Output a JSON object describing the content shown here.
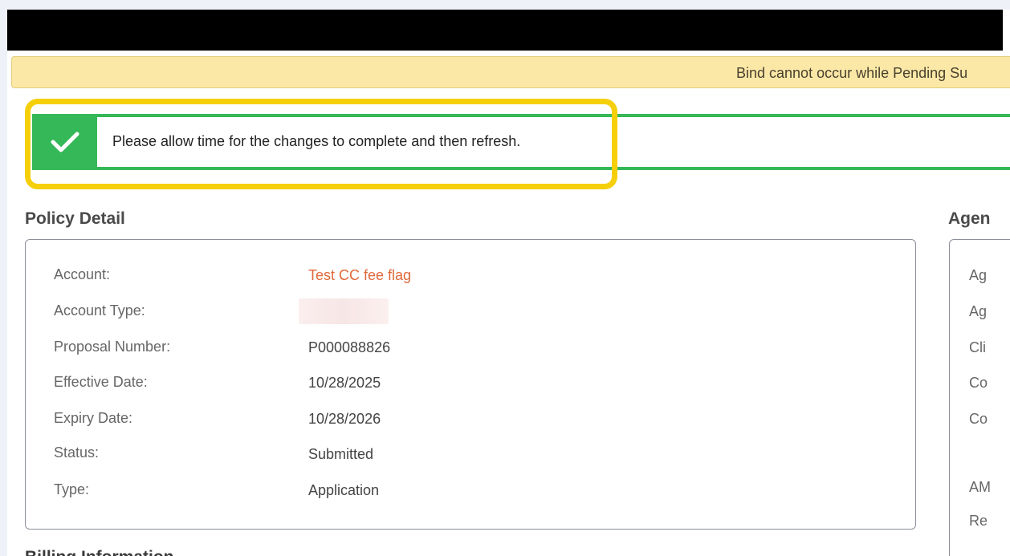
{
  "warning": {
    "text": "Bind cannot occur while Pending Su"
  },
  "success": {
    "message": "Please allow time for the changes to complete and then refresh."
  },
  "policy_detail": {
    "title": "Policy Detail",
    "rows": [
      {
        "label": "Account:",
        "value": "Test CC fee flag"
      },
      {
        "label": "Account Type:",
        "value": ""
      },
      {
        "label": "Proposal Number:",
        "value": "P000088826"
      },
      {
        "label": "Effective Date:",
        "value": "10/28/2025"
      },
      {
        "label": "Expiry Date:",
        "value": "10/28/2026"
      },
      {
        "label": "Status:",
        "value": "Submitted"
      },
      {
        "label": "Type:",
        "value": "Application"
      }
    ]
  },
  "agent_panel": {
    "title": "Agen",
    "labels": [
      "Ag",
      "Ag",
      "Cli",
      "Co",
      "Co",
      "AM",
      "Re"
    ]
  },
  "billing": {
    "title": "Billing Information"
  },
  "colors": {
    "success": "#35b858",
    "highlight": "#f5cf0a",
    "link": "#e0683a",
    "warning_bg": "#fbe8a6"
  }
}
